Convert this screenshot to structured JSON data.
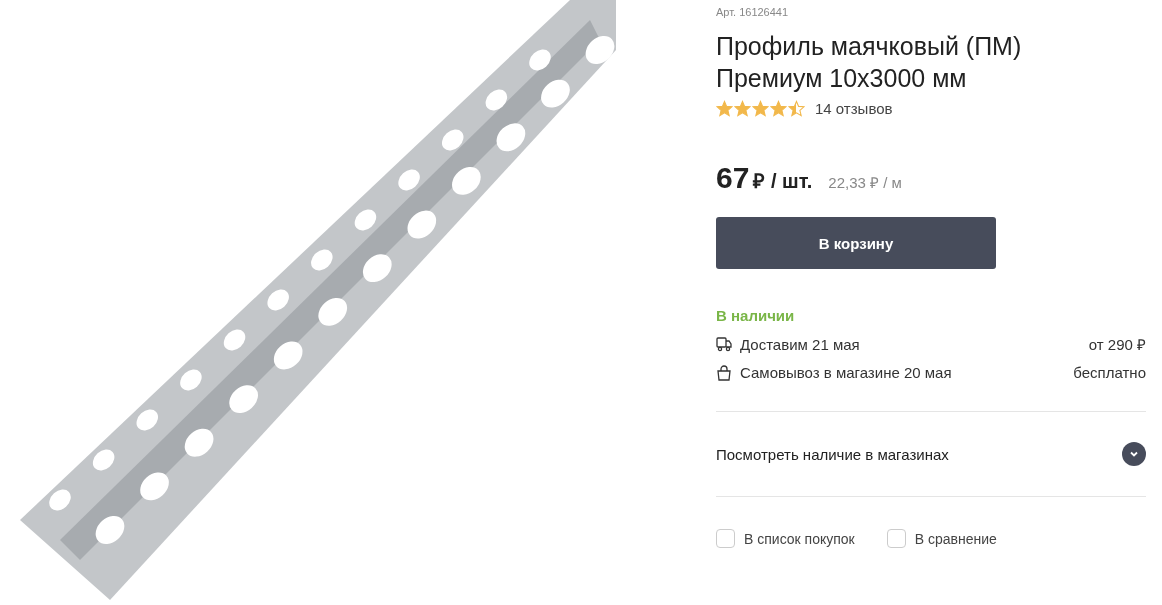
{
  "article": "Арт. 16126441",
  "title": "Профиль маячковый (ПМ) Премиум 10х3000 мм",
  "rating": {
    "stars": 4.5,
    "reviews": "14 отзывов"
  },
  "price": {
    "amount": "67",
    "unit": "₽ / шт.",
    "per_meter": "22,33 ₽ / м"
  },
  "cart_button": "В корзину",
  "availability": "В наличии",
  "delivery": [
    {
      "kind": "truck",
      "label": "Доставим 21 мая",
      "price": "от 290 ₽"
    },
    {
      "kind": "bag",
      "label": "Самовывоз в магазине 20 мая",
      "price": "бесплатно"
    }
  ],
  "stores": {
    "label": "Посмотреть наличие в магазинах",
    "expanded": false
  },
  "options": [
    {
      "label": "В список покупок",
      "checked": false
    },
    {
      "label": "В сравнение",
      "checked": false
    }
  ]
}
